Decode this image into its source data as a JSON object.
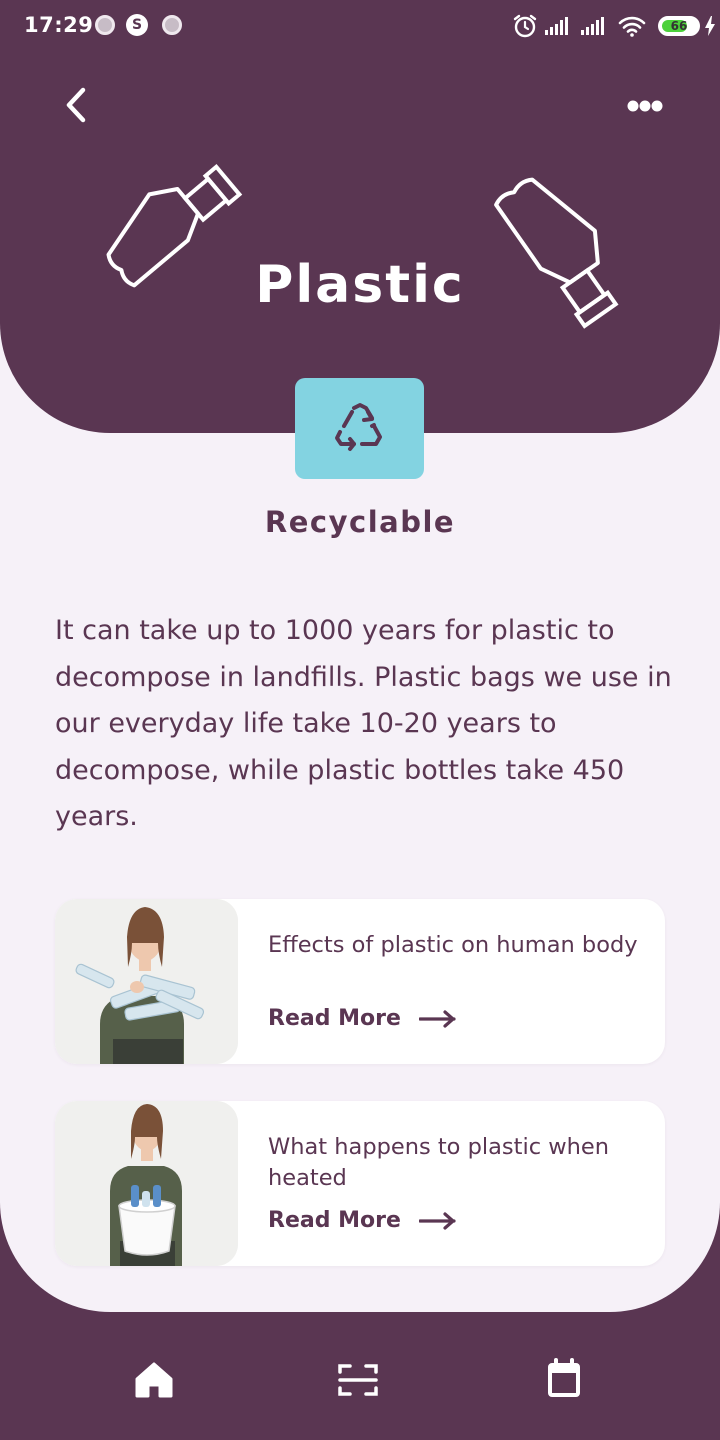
{
  "status_bar": {
    "time": "17:29",
    "battery_level": "66"
  },
  "header": {
    "title": "Plastic",
    "back_icon": "chevron-left-icon",
    "more_icon": "ellipsis-icon"
  },
  "category": {
    "icon": "recycle-icon",
    "label": "Recyclable",
    "badge_color": "#83d3e1"
  },
  "description": "It can take up to 1000 years for plastic to decompose in landfills. Plastic bags we use in our everyday life take 10-20 years to decompose, while plastic bottles take 450 years.",
  "articles": [
    {
      "title": "Effects of plastic on human body",
      "link_label": "Read More"
    },
    {
      "title": "What happens to plastic when heated",
      "link_label": "Read More"
    }
  ],
  "bottom_nav": {
    "items": [
      {
        "icon": "home-icon"
      },
      {
        "icon": "scan-icon"
      },
      {
        "icon": "calendar-icon"
      }
    ]
  },
  "colors": {
    "primary": "#5a3652",
    "background": "#f6f1f8",
    "accent": "#83d3e1"
  }
}
